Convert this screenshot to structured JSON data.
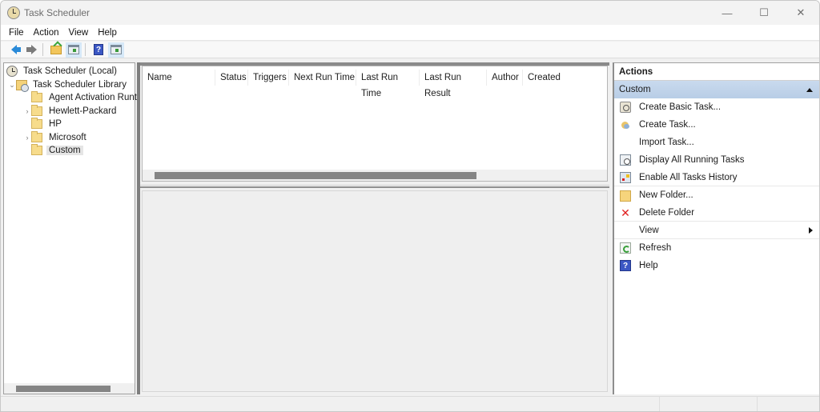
{
  "window": {
    "title": "Task Scheduler",
    "controls": {
      "minimize": "—",
      "maximize": "☐",
      "close": "✕"
    }
  },
  "menubar": {
    "items": [
      "File",
      "Action",
      "View",
      "Help"
    ]
  },
  "toolbar": {
    "buttons": [
      "back-icon",
      "forward-icon",
      "up-folder-icon",
      "show-hide-console-tree-icon",
      "help-icon",
      "show-hide-action-pane-icon"
    ]
  },
  "tree": {
    "root": "Task Scheduler (Local)",
    "library": "Task Scheduler Library",
    "folders": [
      {
        "label": "Agent Activation Runt",
        "expandable": false
      },
      {
        "label": "Hewlett-Packard",
        "expandable": true
      },
      {
        "label": "HP",
        "expandable": false
      },
      {
        "label": "Microsoft",
        "expandable": true
      },
      {
        "label": "Custom",
        "expandable": false,
        "selected": true
      }
    ]
  },
  "task_list": {
    "columns": [
      "Name",
      "Status",
      "Triggers",
      "Next Run Time",
      "Last Run Time",
      "Last Run Result",
      "Author",
      "Created"
    ],
    "rows": []
  },
  "actions": {
    "header": "Actions",
    "section": "Custom",
    "items": [
      {
        "label": "Create Basic Task...",
        "icon": "create-basic-task-icon"
      },
      {
        "label": "Create Task...",
        "icon": "create-task-icon"
      },
      {
        "label": "Import Task...",
        "icon": ""
      },
      {
        "label": "Display All Running Tasks",
        "icon": "running-tasks-icon"
      },
      {
        "label": "Enable All Tasks History",
        "icon": "tasks-history-icon"
      },
      {
        "label": "New Folder...",
        "icon": "new-folder-icon"
      },
      {
        "label": "Delete Folder",
        "icon": "delete-icon"
      },
      {
        "label": "View",
        "icon": "",
        "submenu": true
      },
      {
        "label": "Refresh",
        "icon": "refresh-icon"
      },
      {
        "label": "Help",
        "icon": "help-icon"
      }
    ]
  },
  "colors": {
    "section_header": "#c3d6ec",
    "delete_icon": "#e02020",
    "selection": "#e5e5e5"
  }
}
